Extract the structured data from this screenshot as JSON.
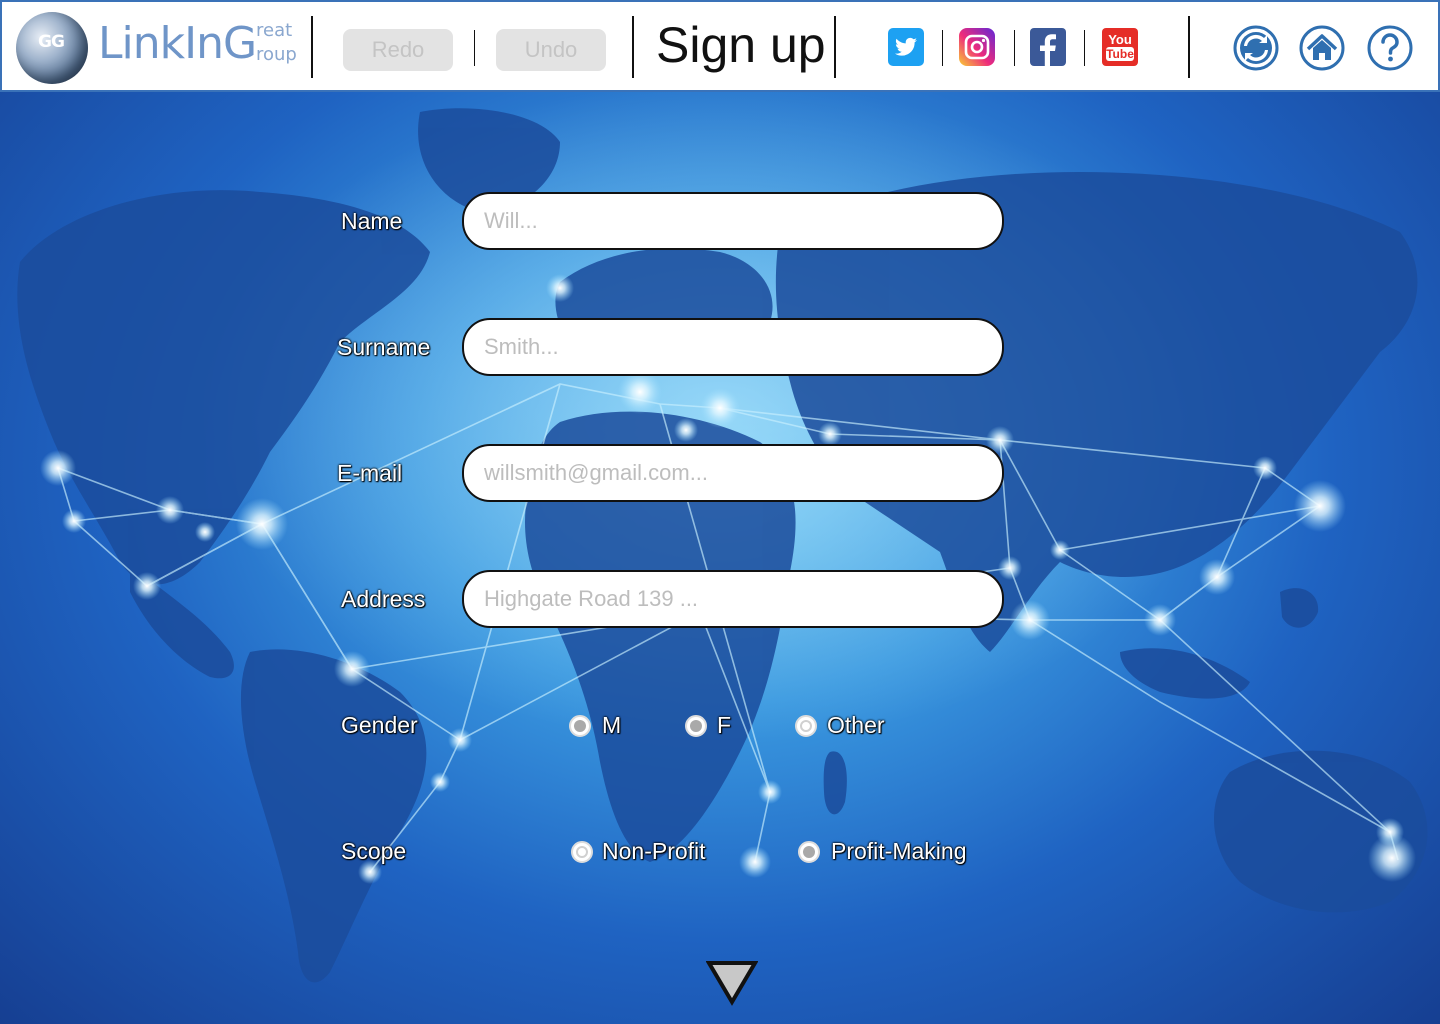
{
  "header": {
    "logo": {
      "initials": "GG",
      "main": "LinkInG",
      "small_top": "reat",
      "small_bottom": "roup"
    },
    "redo_label": "Redo",
    "undo_label": "Undo",
    "title": "Sign up",
    "social": [
      "twitter-icon",
      "instagram-icon",
      "facebook-icon",
      "youtube-icon"
    ],
    "youtube_text_top": "You",
    "youtube_text_bottom": "Tube",
    "nav": [
      "refresh-icon",
      "home-icon",
      "help-icon"
    ]
  },
  "form": {
    "name": {
      "label": "Name",
      "placeholder": "Will..."
    },
    "surname": {
      "label": "Surname",
      "placeholder": "Smith..."
    },
    "email": {
      "label": "E-mail",
      "placeholder": "willsmith@gmail.com..."
    },
    "address": {
      "label": "Address",
      "placeholder": "Highgate Road 139 ..."
    },
    "gender": {
      "label": "Gender",
      "options": [
        {
          "label": "M",
          "state": "filled"
        },
        {
          "label": "F",
          "state": "filled"
        },
        {
          "label": "Other",
          "state": "empty"
        }
      ]
    },
    "scope": {
      "label": "Scope",
      "options": [
        {
          "label": "Non-Profit",
          "state": "empty"
        },
        {
          "label": "Profit-Making",
          "state": "filled"
        }
      ]
    }
  },
  "colors": {
    "header_border": "#3a72b8",
    "logo_text": "#6f95c8",
    "twitter": "#1da1f2",
    "facebook": "#3b5998",
    "youtube": "#e52d27",
    "nav_icon": "#2f6fb0"
  },
  "scroll_icon": "chevron-down-triangle-icon"
}
